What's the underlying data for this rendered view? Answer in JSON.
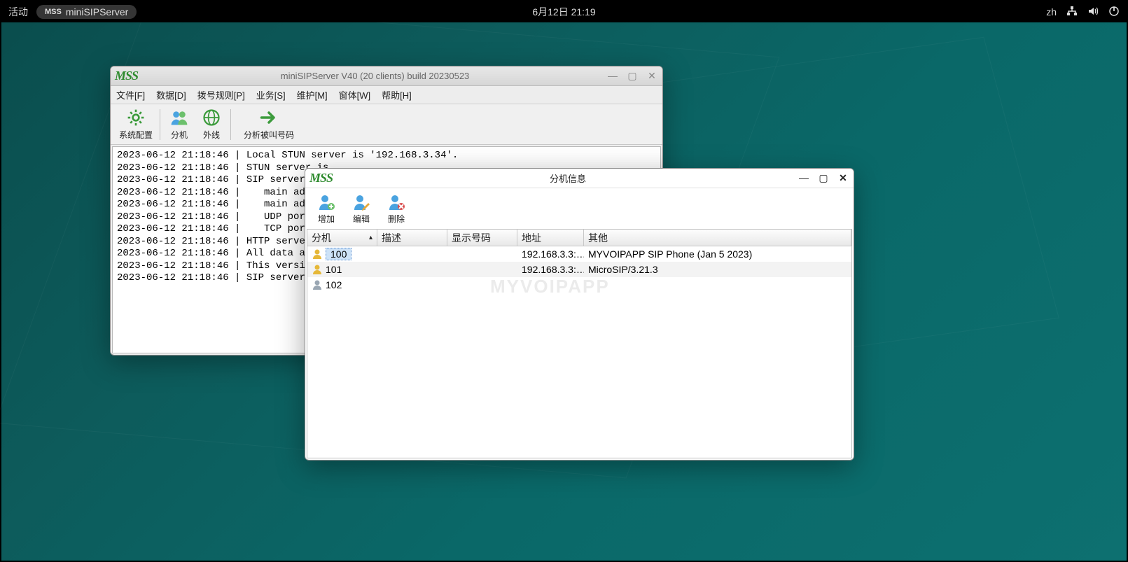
{
  "topbar": {
    "activities": "活动",
    "app_name": "miniSIPServer",
    "datetime": "6月12日  21:19",
    "lang": "zh"
  },
  "main_window": {
    "title": "miniSIPServer V40 (20 clients) build 20230523",
    "menu": {
      "file": "文件[F]",
      "data": "数据[D]",
      "dialplan": "拨号规则[P]",
      "service": "业务[S]",
      "maintain": "维护[M]",
      "window": "窗体[W]",
      "help": "帮助[H]"
    },
    "toolbar": {
      "sysconfig": "系统配置",
      "extension": "分机",
      "external": "外线",
      "analyze": "分析被叫号码"
    },
    "log_lines": [
      "2023-06-12 21:18:46 | Local STUN server is '192.168.3.34'.",
      "2023-06-12 21:18:46 | STUN server is",
      "2023-06-12 21:18:46 | SIP server inf",
      "2023-06-12 21:18:46 |    main addre",
      "2023-06-12 21:18:46 |    main addre",
      "2023-06-12 21:18:46 |    UDP port i",
      "2023-06-12 21:18:46 |    TCP port i",
      "2023-06-12 21:18:46 | HTTP server is",
      "2023-06-12 21:18:46 | All data are s",
      "2023-06-12 21:18:46 | This version i",
      "2023-06-12 21:18:46 | SIP server is "
    ]
  },
  "ext_dialog": {
    "title": "分机信息",
    "toolbar": {
      "add": "增加",
      "edit": "编辑",
      "delete": "删除"
    },
    "headers": {
      "ext": "分机",
      "desc": "描述",
      "disp": "显示号码",
      "addr": "地址",
      "other": "其他"
    },
    "rows": [
      {
        "ext": "100",
        "desc": "",
        "disp": "",
        "addr": "192.168.3.3:…",
        "other": "MYVOIPAPP SIP Phone (Jan  5 2023)",
        "online": true,
        "selected": true
      },
      {
        "ext": "101",
        "desc": "",
        "disp": "",
        "addr": "192.168.3.3:…",
        "other": "MicroSIP/3.21.3",
        "online": true,
        "selected": false
      },
      {
        "ext": "102",
        "desc": "",
        "disp": "",
        "addr": "",
        "other": "",
        "online": false,
        "selected": false
      }
    ]
  },
  "watermark": "MYVOIPAPP"
}
